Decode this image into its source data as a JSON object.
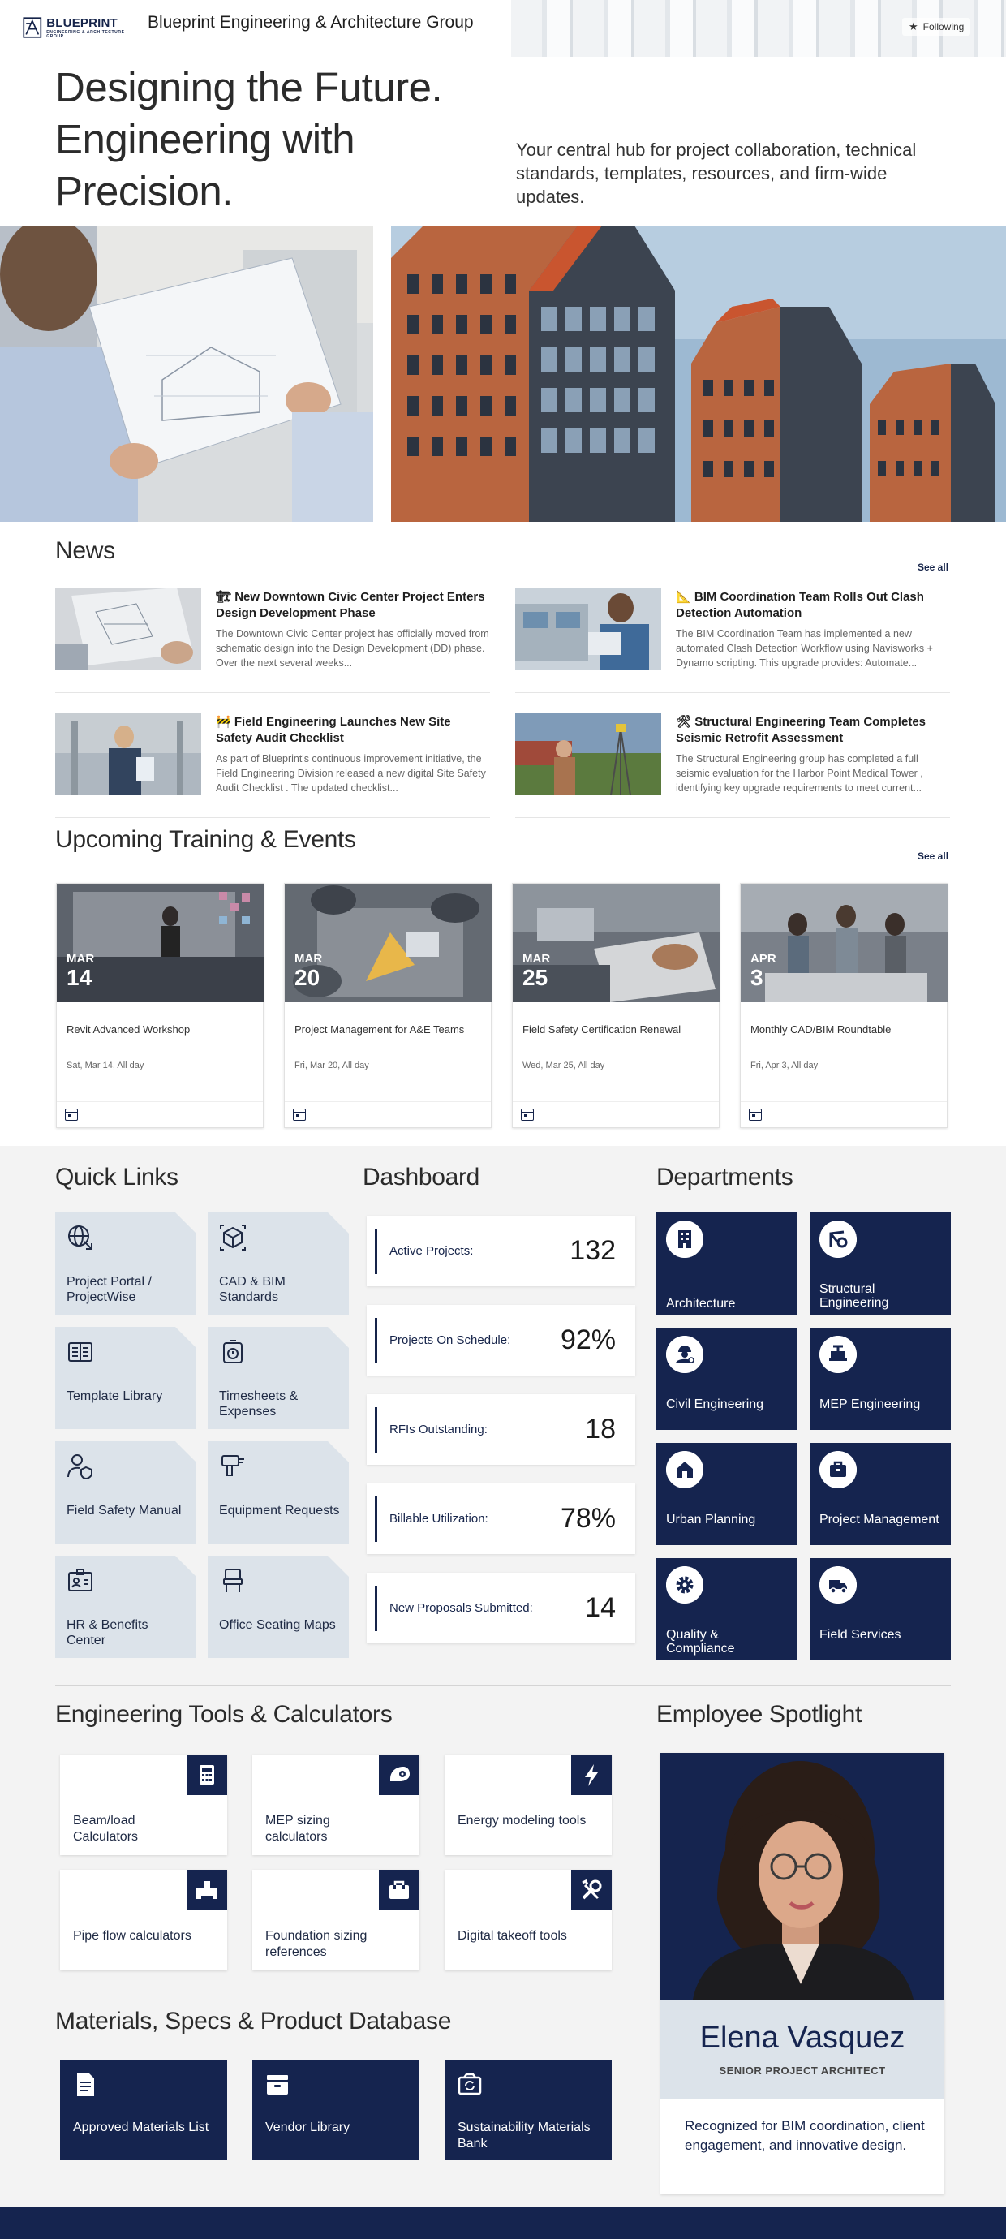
{
  "header": {
    "logo_text": "BLUEPRINT",
    "logo_sub": "ENGINEERING & ARCHITECTURE GROUP",
    "site_title": "Blueprint Engineering & Architecture Group",
    "follow_label": "Following"
  },
  "hero": {
    "title": "Designing the Future. Engineering with Precision.",
    "subtitle": "Your central hub for project collaboration, technical standards, templates, resources, and firm-wide updates."
  },
  "news": {
    "title": "News",
    "see_all": "See all",
    "items": [
      {
        "icon": "🏗",
        "headline": "New Downtown Civic Center Project Enters Design Development Phase",
        "body": "The Downtown Civic Center project has officially moved from schematic design into the Design Development (DD) phase. Over the next several weeks..."
      },
      {
        "icon": "📐",
        "headline": "BIM Coordination Team Rolls Out Clash Detection Automation",
        "body": "The BIM Coordination Team has implemented a new automated Clash Detection Workflow using Navisworks + Dynamo scripting. This upgrade provides: Automate..."
      },
      {
        "icon": "🚧",
        "headline": "Field Engineering Launches New Site Safety Audit Checklist",
        "body": "As part of Blueprint's continuous improvement initiative, the Field Engineering Division released a new digital Site Safety Audit Checklist . The updated checklist..."
      },
      {
        "icon": "🛠",
        "headline": "Structural Engineering Team Completes Seismic Retrofit Assessment",
        "body": "The Structural Engineering group has completed a full seismic evaluation for the Harbor Point Medical Tower , identifying key upgrade requirements to meet current..."
      }
    ]
  },
  "events": {
    "title": "Upcoming Training & Events",
    "see_all": "See all",
    "items": [
      {
        "month": "MAR",
        "day": "14",
        "name": "Revit Advanced Workshop",
        "when": "Sat, Mar 14, All day"
      },
      {
        "month": "MAR",
        "day": "20",
        "name": "Project Management for A&E Teams",
        "when": "Fri, Mar 20, All day"
      },
      {
        "month": "MAR",
        "day": "25",
        "name": "Field Safety Certification Renewal",
        "when": "Wed, Mar 25, All day"
      },
      {
        "month": "APR",
        "day": "3",
        "name": "Monthly CAD/BIM Roundtable",
        "when": "Fri, Apr 3, All day"
      }
    ]
  },
  "quick_links": {
    "title": "Quick Links",
    "items": [
      {
        "label": "Project Portal / ProjectWise",
        "icon": "globe-icon"
      },
      {
        "label": "CAD & BIM Standards",
        "icon": "cube-icon"
      },
      {
        "label": "Template Library",
        "icon": "document-grid-icon"
      },
      {
        "label": "Timesheets & Expenses",
        "icon": "timer-icon"
      },
      {
        "label": "Field Safety Manual",
        "icon": "person-shield-icon"
      },
      {
        "label": "Equipment Requests",
        "icon": "drill-icon"
      },
      {
        "label": "HR & Benefits Center",
        "icon": "id-badge-icon"
      },
      {
        "label": "Office Seating Maps",
        "icon": "seat-icon"
      }
    ]
  },
  "dashboard": {
    "title": "Dashboard",
    "items": [
      {
        "label": "Active Projects:",
        "value": "132"
      },
      {
        "label": "Projects On Schedule:",
        "value": "92%"
      },
      {
        "label": "RFIs Outstanding:",
        "value": "18"
      },
      {
        "label": "Billable Utilization:",
        "value": "78%"
      },
      {
        "label": "New Proposals Submitted:",
        "value": "14"
      }
    ]
  },
  "departments": {
    "title": "Departments",
    "items": [
      {
        "label": "Architecture",
        "icon": "building-icon"
      },
      {
        "label": "Structural Engineering",
        "icon": "crane-icon"
      },
      {
        "label": "Civil Engineering",
        "icon": "worker-icon"
      },
      {
        "label": "MEP Engineering",
        "icon": "valve-icon"
      },
      {
        "label": "Urban Planning",
        "icon": "house-icon"
      },
      {
        "label": "Project Management",
        "icon": "briefcase-icon"
      },
      {
        "label": "Quality & Compliance",
        "icon": "gear-icon"
      },
      {
        "label": "Field Services",
        "icon": "truck-icon"
      }
    ]
  },
  "tools": {
    "title": "Engineering Tools & Calculators",
    "items": [
      {
        "label": "Beam/load Calculators",
        "icon": "calculator-icon"
      },
      {
        "label": "MEP sizing calculators",
        "icon": "duct-icon"
      },
      {
        "label": "Energy modeling tools",
        "icon": "lightning-icon"
      },
      {
        "label": "Pipe flow calculators",
        "icon": "pipe-icon"
      },
      {
        "label": "Foundation sizing references",
        "icon": "toolbox-icon"
      },
      {
        "label": "Digital takeoff tools",
        "icon": "wrench-icon"
      }
    ]
  },
  "materials": {
    "title": "Materials, Specs & Product Database",
    "items": [
      {
        "label": "Approved Materials List",
        "icon": "document-icon"
      },
      {
        "label": "Vendor Library",
        "icon": "archive-icon"
      },
      {
        "label": "Sustainability Materials Bank",
        "icon": "recycle-box-icon"
      }
    ]
  },
  "spotlight": {
    "title": "Employee Spotlight",
    "name": "Elena Vasquez",
    "role": "SENIOR PROJECT ARCHITECT",
    "description": "Recognized for BIM coordination, client engagement, and innovative design."
  },
  "colors": {
    "navy": "#15244f",
    "tile_grey_blue": "#dce3ea",
    "band_grey": "#f3f3f3"
  }
}
